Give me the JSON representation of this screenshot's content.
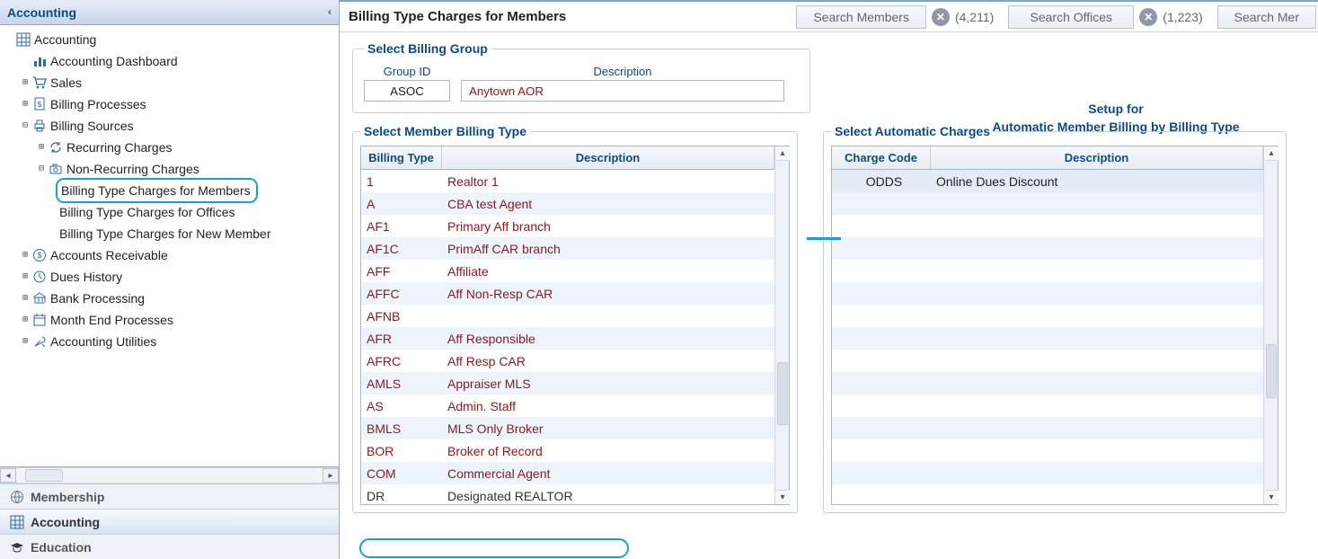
{
  "sidebar": {
    "title": "Accounting",
    "root": "Accounting",
    "dashboard": "Accounting Dashboard",
    "sales": "Sales",
    "billingProcesses": "Billing Processes",
    "billingSources": "Billing Sources",
    "recurring": "Recurring Charges",
    "nonRecurring": "Non-Recurring Charges",
    "btcMembers": "Billing Type Charges for Members",
    "btcOffices": "Billing Type Charges for Offices",
    "btcNew": "Billing Type Charges for New Member",
    "ar": "Accounts Receivable",
    "duesHistory": "Dues History",
    "bankProcessing": "Bank Processing",
    "monthEnd": "Month End Processes",
    "utilities": "Accounting Utilities"
  },
  "bottomNav": {
    "membership": "Membership",
    "accounting": "Accounting",
    "education": "Education"
  },
  "header": {
    "title": "Billing Type Charges for Members",
    "searchMembersPh": "Search Members",
    "membersCount": "(4,211)",
    "searchOfficesPh": "Search Offices",
    "officesCount": "(1,223)",
    "searchMerPh": "Search Mer"
  },
  "billingGroup": {
    "legend": "Select Billing Group",
    "groupIdLabel": "Group ID",
    "groupId": "ASOC",
    "descLabel": "Description",
    "desc": "Anytown AOR"
  },
  "setup": {
    "line1": "Setup for",
    "line2": "Automatic Member Billing by Billing Type"
  },
  "billingTypes": {
    "legend": "Select Member Billing Type",
    "colType": "Billing Type",
    "colDesc": "Description",
    "rows": [
      {
        "t": "1",
        "d": "Realtor 1"
      },
      {
        "t": "A",
        "d": "CBA test Agent"
      },
      {
        "t": "AF1",
        "d": "Primary Aff branch"
      },
      {
        "t": "AF1C",
        "d": "PrimAff CAR branch"
      },
      {
        "t": "AFF",
        "d": "Affiliate"
      },
      {
        "t": "AFFC",
        "d": "Aff Non-Resp CAR"
      },
      {
        "t": "AFNB",
        "d": ""
      },
      {
        "t": "AFR",
        "d": "Aff Responsible"
      },
      {
        "t": "AFRC",
        "d": "Aff Resp CAR"
      },
      {
        "t": "AMLS",
        "d": "Appraiser MLS"
      },
      {
        "t": "AS",
        "d": "Admin. Staff"
      },
      {
        "t": "BMLS",
        "d": "MLS Only Broker"
      },
      {
        "t": "BOR",
        "d": "Broker of Record"
      },
      {
        "t": "COM",
        "d": "Commercial Agent"
      },
      {
        "t": "DR",
        "d": "Designated REALTOR"
      }
    ]
  },
  "autoCharges": {
    "legend": "Select Automatic Charges",
    "colCode": "Charge Code",
    "colDesc": "Description",
    "rows": [
      {
        "c": "ODDS",
        "d": "Online Dues Discount"
      }
    ]
  }
}
